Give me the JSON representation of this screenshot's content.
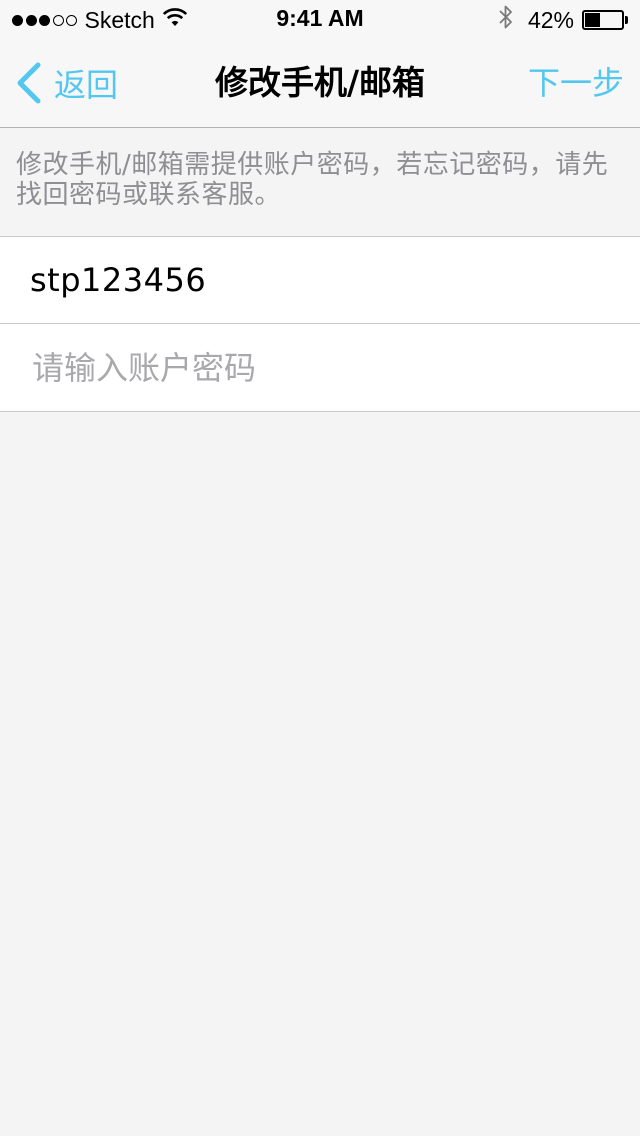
{
  "status_bar": {
    "carrier": "Sketch",
    "signal_bars_filled": 3,
    "signal_bars_total": 5,
    "time": "9:41 AM",
    "battery_percent": "42%",
    "battery_level": 0.42,
    "icons": [
      "wifi-icon",
      "bluetooth-icon",
      "battery-icon"
    ]
  },
  "nav": {
    "back_label": "返回",
    "title": "修改手机/邮箱",
    "next_label": "下一步",
    "accent_color": "#52c7f0"
  },
  "info": {
    "text": "修改手机/邮箱需提供账户密码，若忘记密码，请先找回密码或联系客服。"
  },
  "form": {
    "account": "stp123456",
    "password": {
      "value": "",
      "placeholder": "请输入账户密码"
    }
  }
}
